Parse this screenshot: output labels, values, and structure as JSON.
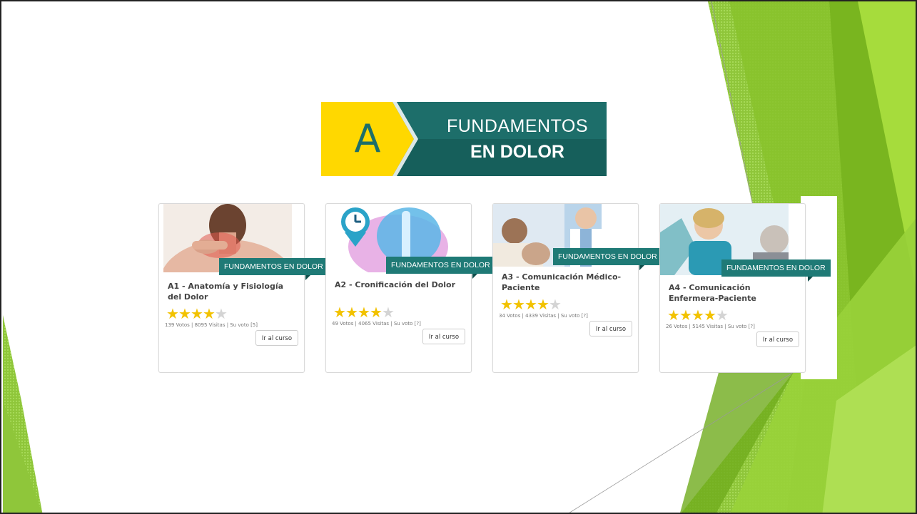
{
  "header": {
    "letter": "A",
    "line1": "FUNDAMENTOS",
    "line2": "EN DOLOR"
  },
  "colors": {
    "banner_yellow": "#ffd800",
    "banner_teal": "#1d6e6a",
    "ribbon_teal": "#1f7a76",
    "star_on": "#f2c200",
    "star_off": "#d4d4d4",
    "green_light": "#9bd32e",
    "green_dark": "#6aa31c"
  },
  "cards": [
    {
      "image": "shoulder-pain-photo",
      "ribbon": "FUNDAMENTOS EN DOLOR",
      "title": "A1 - Anatomía y Fisiología del Dolor",
      "rating": 4,
      "stats": "139 Votos | 8095 Visitas | Su voto [5]",
      "button": "Ir al curso"
    },
    {
      "image": "spine-clock-illustration",
      "ribbon": "FUNDAMENTOS EN DOLOR",
      "title": "A2 - Cronificación del Dolor",
      "rating": 4,
      "stats": "49 Votos | 4065 Visitas | Su voto [?]",
      "button": "Ir al curso"
    },
    {
      "image": "doctor-patient-photo",
      "ribbon": "FUNDAMENTOS EN DOLOR",
      "title": "A3 - Comunicación Médico-Paciente",
      "rating": 4,
      "stats": "34 Votos | 4339 Visitas | Su voto [?]",
      "button": "Ir al curso"
    },
    {
      "image": "nurse-patient-photo",
      "ribbon": "FUNDAMENTOS EN DOLOR",
      "title": "A4 - Comunicación Enfermera-Paciente",
      "rating": 4,
      "stats": "26 Votos | 5145 Visitas | Su voto [?]",
      "button": "Ir al curso"
    }
  ]
}
